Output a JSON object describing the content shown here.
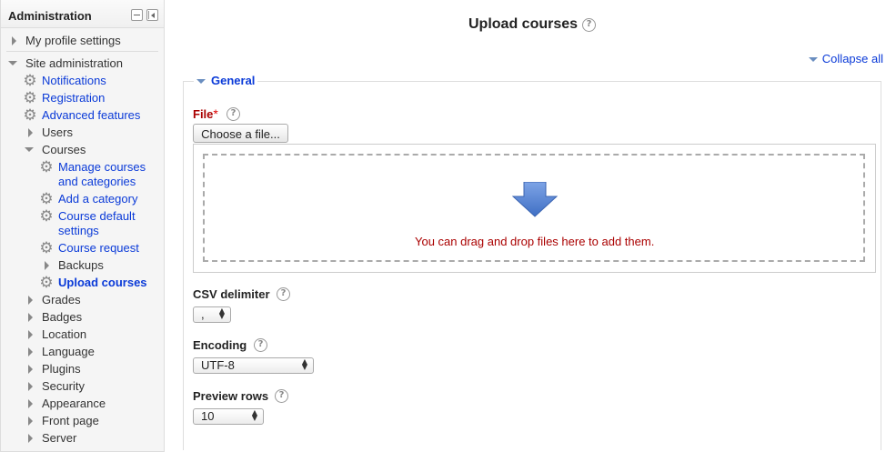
{
  "sidebar": {
    "title": "Administration",
    "items": {
      "my_profile": "My profile settings",
      "site_admin": "Site administration",
      "notifications": "Notifications",
      "registration": "Registration",
      "advanced_features": "Advanced features",
      "users": "Users",
      "courses": "Courses",
      "manage_courses_l1": "Manage courses",
      "manage_courses_l2": "and categories",
      "add_category": "Add a category",
      "course_default_l1": "Course default",
      "course_default_l2": "settings",
      "course_request": "Course request",
      "backups": "Backups",
      "upload_courses": "Upload courses",
      "grades": "Grades",
      "badges": "Badges",
      "location": "Location",
      "language": "Language",
      "plugins": "Plugins",
      "security": "Security",
      "appearance": "Appearance",
      "front_page": "Front page",
      "server": "Server"
    }
  },
  "main": {
    "title": "Upload courses",
    "collapse_all": "Collapse all",
    "section_general": "General",
    "file_label": "File",
    "required_marker": "*",
    "choose_file_button": "Choose a file...",
    "drop_text": "You can drag and drop files here to add them.",
    "csv_delimiter_label": "CSV delimiter",
    "csv_delimiter_value": ",",
    "encoding_label": "Encoding",
    "encoding_value": "UTF-8",
    "preview_rows_label": "Preview rows",
    "preview_rows_value": "10"
  },
  "icons": {
    "help": "?",
    "gear": "⚙"
  },
  "colors": {
    "link": "#0a3ad8",
    "required": "#aa0000",
    "drop_arrow": "#5b8ad6"
  }
}
